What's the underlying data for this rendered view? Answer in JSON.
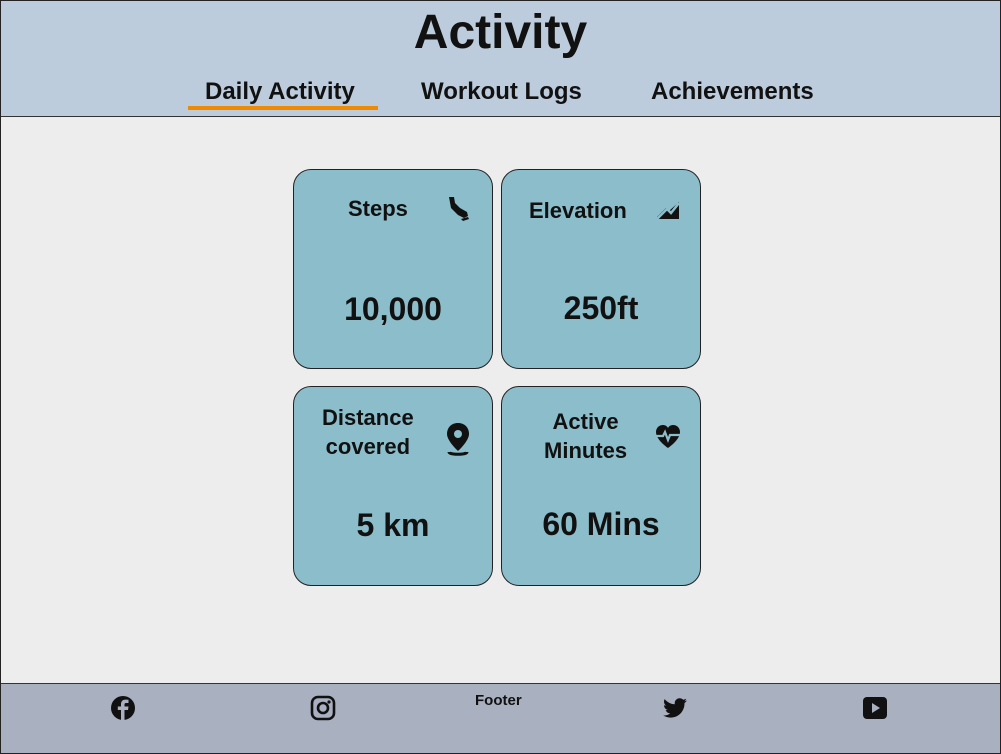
{
  "header": {
    "title": "Activity",
    "tabs": [
      {
        "label": "Daily Activity",
        "active": true
      },
      {
        "label": "Workout Logs",
        "active": false
      },
      {
        "label": "Achievements",
        "active": false
      }
    ]
  },
  "cards": [
    {
      "label": "Steps",
      "value": "10,000",
      "icon": "shoe-icon"
    },
    {
      "label": "Elevation",
      "value": "250ft",
      "icon": "elevation-icon"
    },
    {
      "label_line1": "Distance",
      "label_line2": "covered",
      "value": "5 km",
      "icon": "location-pin-icon"
    },
    {
      "label_line1": "Active",
      "label_line2": "Minutes",
      "value": "60 Mins",
      "icon": "heart-pulse-icon"
    }
  ],
  "footer": {
    "label": "Footer",
    "social": [
      "facebook-icon",
      "instagram-icon",
      "twitter-icon",
      "youtube-icon"
    ]
  },
  "colors": {
    "header_bg": "#bdccdc",
    "body_bg": "#ededed",
    "card_bg": "#8cbdcb",
    "footer_bg": "#a9b0c0",
    "active_tab_accent": "#f08a00"
  }
}
